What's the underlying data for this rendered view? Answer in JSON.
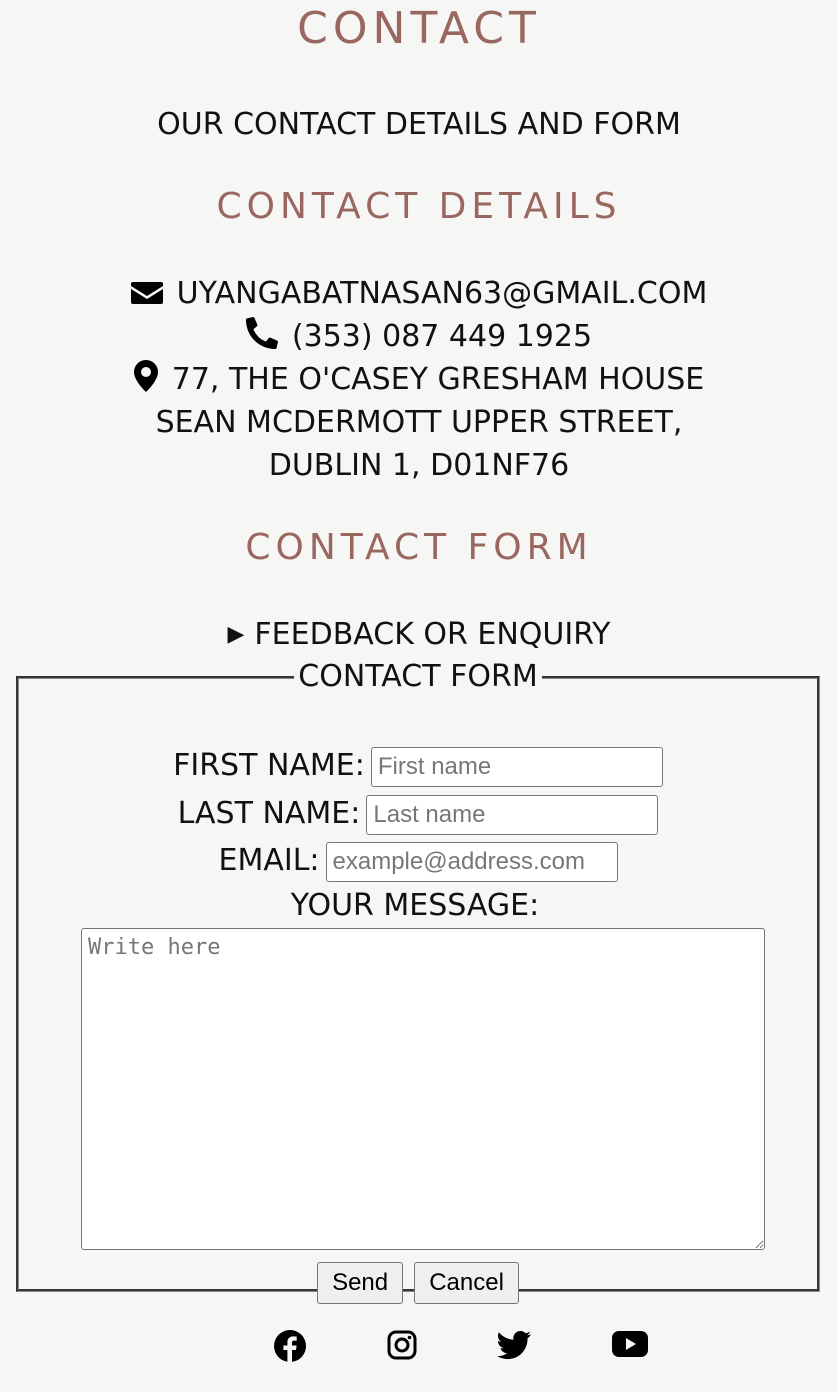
{
  "page": {
    "title": "CONTACT",
    "subtitle": "OUR CONTACT DETAILS AND FORM"
  },
  "details": {
    "heading": "CONTACT DETAILS",
    "email": "UYANGABATNASAN63@GMAIL.COM",
    "phone": "(353) 087 449 1925",
    "address_line1": "77, THE O'CASEY GRESHAM HOUSE",
    "address_line2": "SEAN MCDERMOTT UPPER STREET,",
    "address_line3": "DUBLIN 1, D01NF76"
  },
  "form_section": {
    "heading": "CONTACT FORM",
    "summary": "FEEDBACK OR ENQUIRY",
    "legend": "CONTACT FORM",
    "first_name_label": "FIRST NAME:",
    "first_name_placeholder": "First name",
    "first_name_value": "",
    "last_name_label": "LAST NAME:",
    "last_name_placeholder": "Last name",
    "last_name_value": "",
    "email_label": "EMAIL:",
    "email_placeholder": "example@address.com",
    "email_value": "",
    "message_label": "YOUR MESSAGE:",
    "message_placeholder": "Write here",
    "send_label": "Send",
    "cancel_label": "Cancel"
  },
  "social": {
    "icons": [
      "facebook-icon",
      "instagram-icon",
      "twitter-icon",
      "youtube-icon"
    ]
  },
  "colors": {
    "heading": "#9a6660",
    "background": "#f6f6f4"
  }
}
